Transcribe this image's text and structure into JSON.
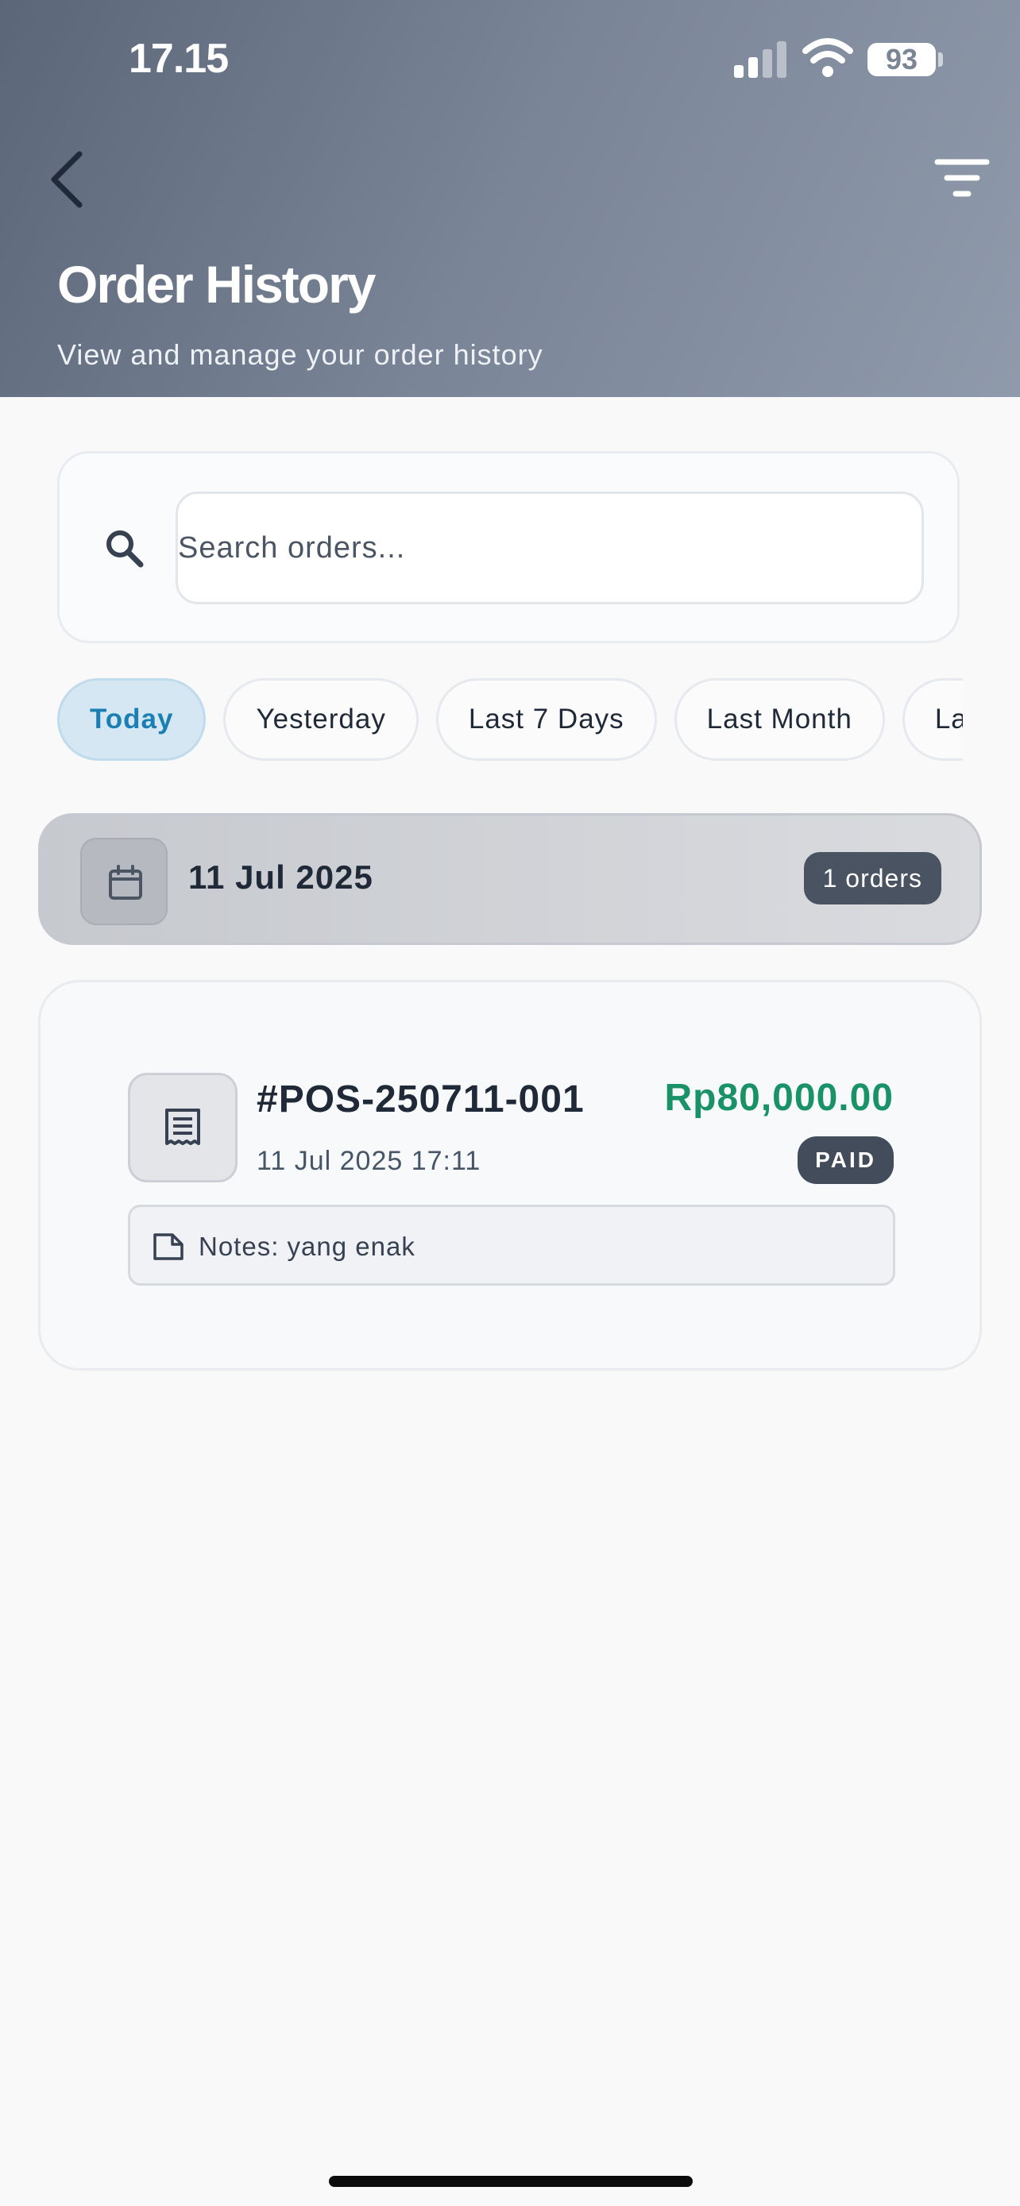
{
  "status_bar": {
    "time": "17.15",
    "battery": "93",
    "icons": [
      "signal-icon",
      "wifi-icon",
      "battery-icon"
    ]
  },
  "header": {
    "title": "Order History",
    "subtitle": "View and manage your order history",
    "back_icon": "chevron-left-icon",
    "filter_icon": "filter-icon",
    "gradient_from": "#5b6779",
    "gradient_to": "#8f9aab"
  },
  "search": {
    "placeholder": "Search orders...",
    "value": "",
    "icon": "search-icon"
  },
  "filters": {
    "chips": [
      "Today",
      "Yesterday",
      "Last 7 Days",
      "Last Month",
      "La"
    ],
    "active": "Today",
    "active_color": "#1b7fb3"
  },
  "groups": [
    {
      "date": "11 Jul 2025",
      "count_label": "1 orders",
      "icon": "calendar-icon",
      "orders": [
        {
          "id": "#POS-250711-001",
          "datetime": "11 Jul 2025 17:11",
          "amount": "Rp80,000.00",
          "status": "PAID",
          "notes": "Notes: yang enak",
          "icon": "receipt-icon",
          "notes_icon": "note-icon",
          "amount_color": "#189266"
        }
      ]
    }
  ]
}
